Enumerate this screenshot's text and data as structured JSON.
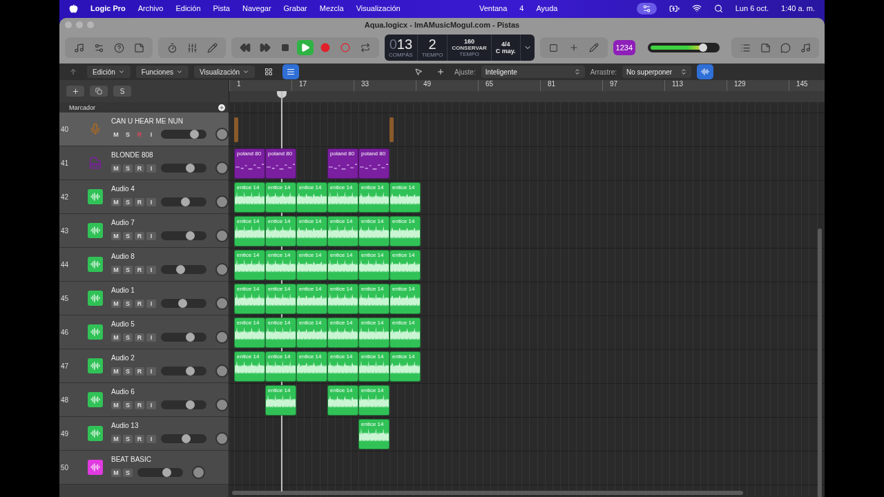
{
  "menu_bar": {
    "app": "Logic Pro",
    "items": [
      "Archivo",
      "Edición",
      "Pista",
      "Navegar",
      "Grabar",
      "Mezcla",
      "Visualización",
      "Ventana",
      "4",
      "Ayuda"
    ],
    "date": "Lun 6 oct.",
    "time": "1:40 a. m."
  },
  "window": {
    "title": "Aqua.logicx - ImAMusicMogul.com - Pistas"
  },
  "lcd": {
    "bar_dim": "0",
    "bar": "13",
    "beat": "2",
    "bar_label": "COMPÁS",
    "beat_label": "TIEMPO",
    "tempo": "160",
    "tempo_mode": "CONSERVAR",
    "tempo_label": "TEMPO",
    "signature": "4/4",
    "key": "C may."
  },
  "count_in": {
    "label": "1234",
    "on": true
  },
  "master": {
    "level": 0.8
  },
  "edit_bar": {
    "menus": [
      "Edición",
      "Funciones",
      "Visualización"
    ],
    "snap_label": "Ajuste:",
    "snap_value": "Inteligente",
    "drag_label": "Arrastre:",
    "drag_value": "No superponer"
  },
  "track_header": {
    "solo_label": "S",
    "marker_label": "Marcador"
  },
  "ruler": [
    "1",
    "17",
    "33",
    "49",
    "65",
    "81",
    "97",
    "113",
    "129",
    "145"
  ],
  "tracks": [
    {
      "number": "40",
      "name": "CAN U HEAR ME NUN",
      "kind": "mic",
      "color": "#b06a1e",
      "selected": true,
      "buttons": [
        {
          "label": "M",
          "on": false
        },
        {
          "label": "S",
          "on": false
        },
        {
          "label": "R",
          "on": true
        },
        {
          "label": "I",
          "on": false
        }
      ],
      "level": 0.8,
      "regions": [
        {
          "kind": "marker"
        },
        {
          "kind": "gap"
        },
        {
          "kind": "gap"
        },
        {
          "kind": "gap"
        },
        {
          "kind": "gap"
        },
        {
          "kind": "marker"
        }
      ]
    },
    {
      "number": "41",
      "name": "BLONDE 808",
      "kind": "keys",
      "color": "#7a1fa0",
      "selected": false,
      "buttons": [
        {
          "label": "M",
          "on": false
        },
        {
          "label": "S",
          "on": false
        },
        {
          "label": "R",
          "on": false
        },
        {
          "label": "I",
          "on": false
        }
      ],
      "level": 0.68,
      "regions": [
        {
          "kind": "midi",
          "label": "poland 80"
        },
        {
          "kind": "midi",
          "label": "poland 80"
        },
        {
          "kind": "gap"
        },
        {
          "kind": "midi",
          "label": "poland 80"
        },
        {
          "kind": "midi",
          "label": "poland 80"
        }
      ]
    },
    {
      "number": "42",
      "name": "Audio 4",
      "kind": "audio",
      "color": "#31c257",
      "selected": false,
      "buttons": [
        {
          "label": "M",
          "on": false
        },
        {
          "label": "S",
          "on": false
        },
        {
          "label": "R",
          "on": false
        },
        {
          "label": "I",
          "on": false
        }
      ],
      "level": 0.55,
      "regions": [
        {
          "kind": "audio",
          "label": "entice 14"
        },
        {
          "kind": "audio",
          "label": "entice 14"
        },
        {
          "kind": "audio",
          "label": "entice 14"
        },
        {
          "kind": "audio",
          "label": "entice 14"
        },
        {
          "kind": "audio",
          "label": "entice 14"
        },
        {
          "kind": "audio",
          "label": "entice 14"
        }
      ]
    },
    {
      "number": "43",
      "name": "Audio 7",
      "kind": "audio",
      "color": "#31c257",
      "selected": false,
      "buttons": [
        {
          "label": "M",
          "on": false
        },
        {
          "label": "S",
          "on": false
        },
        {
          "label": "R",
          "on": false
        },
        {
          "label": "I",
          "on": false
        }
      ],
      "level": 0.68,
      "regions": [
        {
          "kind": "audio",
          "label": "entice 14"
        },
        {
          "kind": "audio",
          "label": "entice 14"
        },
        {
          "kind": "audio",
          "label": "entice 14"
        },
        {
          "kind": "audio",
          "label": "entice 14"
        },
        {
          "kind": "audio",
          "label": "entice 14"
        },
        {
          "kind": "audio",
          "label": "entice 14"
        }
      ]
    },
    {
      "number": "44",
      "name": "Audio 8",
      "kind": "audio",
      "color": "#31c257",
      "selected": false,
      "buttons": [
        {
          "label": "M",
          "on": false
        },
        {
          "label": "S",
          "on": false
        },
        {
          "label": "R",
          "on": false
        },
        {
          "label": "I",
          "on": false
        }
      ],
      "level": 0.42,
      "regions": [
        {
          "kind": "audio",
          "label": "entice 14"
        },
        {
          "kind": "audio",
          "label": "entice 14"
        },
        {
          "kind": "audio",
          "label": "entice 14"
        },
        {
          "kind": "audio",
          "label": "entice 14"
        },
        {
          "kind": "audio",
          "label": "entice 14"
        },
        {
          "kind": "audio",
          "label": "entice 14"
        }
      ]
    },
    {
      "number": "45",
      "name": "Audio 1",
      "kind": "audio",
      "color": "#31c257",
      "selected": false,
      "buttons": [
        {
          "label": "M",
          "on": false
        },
        {
          "label": "S",
          "on": false
        },
        {
          "label": "R",
          "on": false
        },
        {
          "label": "I",
          "on": false
        }
      ],
      "level": 0.47,
      "regions": [
        {
          "kind": "audio",
          "label": "entice 14"
        },
        {
          "kind": "audio",
          "label": "entice 14"
        },
        {
          "kind": "audio",
          "label": "entice 14"
        },
        {
          "kind": "audio",
          "label": "entice 14"
        },
        {
          "kind": "audio",
          "label": "entice 14"
        },
        {
          "kind": "audio",
          "label": "entice 14"
        }
      ]
    },
    {
      "number": "46",
      "name": "Audio 5",
      "kind": "audio",
      "color": "#31c257",
      "selected": false,
      "buttons": [
        {
          "label": "M",
          "on": false
        },
        {
          "label": "S",
          "on": false
        },
        {
          "label": "R",
          "on": false
        },
        {
          "label": "I",
          "on": false
        }
      ],
      "level": 0.68,
      "regions": [
        {
          "kind": "audio",
          "label": "entice 14"
        },
        {
          "kind": "audio",
          "label": "entice 14"
        },
        {
          "kind": "audio",
          "label": "entice 14"
        },
        {
          "kind": "audio",
          "label": "entice 14"
        },
        {
          "kind": "audio",
          "label": "entice 14"
        },
        {
          "kind": "audio",
          "label": "entice 14"
        }
      ]
    },
    {
      "number": "47",
      "name": "Audio 2",
      "kind": "audio",
      "color": "#31c257",
      "selected": false,
      "buttons": [
        {
          "label": "M",
          "on": false
        },
        {
          "label": "S",
          "on": false
        },
        {
          "label": "R",
          "on": false
        },
        {
          "label": "I",
          "on": false
        }
      ],
      "level": 0.68,
      "regions": [
        {
          "kind": "audio",
          "label": "entice 14"
        },
        {
          "kind": "audio",
          "label": "entice 14"
        },
        {
          "kind": "audio",
          "label": "entice 14"
        },
        {
          "kind": "audio",
          "label": "entice 14"
        },
        {
          "kind": "audio",
          "label": "entice 14"
        },
        {
          "kind": "audio",
          "label": "entice 14"
        }
      ]
    },
    {
      "number": "48",
      "name": "Audio 6",
      "kind": "audio",
      "color": "#31c257",
      "selected": false,
      "buttons": [
        {
          "label": "M",
          "on": false
        },
        {
          "label": "S",
          "on": false
        },
        {
          "label": "R",
          "on": false
        },
        {
          "label": "I",
          "on": false
        }
      ],
      "level": 0.68,
      "regions": [
        {
          "kind": "gap"
        },
        {
          "kind": "audio",
          "label": "entice 14"
        },
        {
          "kind": "gap"
        },
        {
          "kind": "audio",
          "label": "entice 14"
        },
        {
          "kind": "audio",
          "label": "entice 14"
        }
      ]
    },
    {
      "number": "49",
      "name": "Audio 13",
      "kind": "audio",
      "color": "#31c257",
      "selected": false,
      "buttons": [
        {
          "label": "M",
          "on": false
        },
        {
          "label": "S",
          "on": false
        },
        {
          "label": "R",
          "on": false
        },
        {
          "label": "I",
          "on": false
        }
      ],
      "level": 0.57,
      "regions": [
        {
          "kind": "gap"
        },
        {
          "kind": "gap"
        },
        {
          "kind": "gap"
        },
        {
          "kind": "gap"
        },
        {
          "kind": "audio",
          "label": "entice 14"
        }
      ]
    },
    {
      "number": "50",
      "name": "BEAT BASIC",
      "kind": "beat",
      "color": "#e03ae0",
      "selected": false,
      "buttons": [
        {
          "label": "M",
          "on": false
        },
        {
          "label": "S",
          "on": false
        }
      ],
      "level": 0.68
    }
  ]
}
